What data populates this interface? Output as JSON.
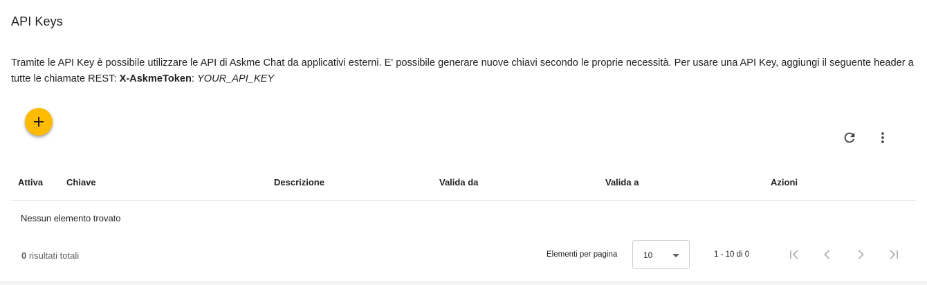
{
  "page": {
    "title": "API Keys",
    "description": {
      "text": "Tramite le API Key è possibile utilizzare le API di Askme Chat da applicativi esterni. E' possibile generare nuove chiavi secondo le proprie necessità. Per usare una API Key, aggiungi il seguente header a tutte le chiamate REST: ",
      "header_name": "X-AskmeToken",
      "separator": ": ",
      "header_value": "YOUR_API_KEY"
    }
  },
  "toolbar": {
    "add_icon": "plus-icon",
    "refresh_icon": "refresh-icon",
    "more_icon": "more-vertical-icon"
  },
  "table": {
    "columns": [
      "Attiva",
      "Chiave",
      "Descrizione",
      "Valida da",
      "Valida a",
      "Azioni"
    ],
    "rows": [],
    "empty_message": "Nessun elemento trovato"
  },
  "footer": {
    "total_count": "0",
    "total_label": " risultati totali",
    "per_page_label": "Elementi per pagina",
    "per_page_value": "10",
    "range_label": "1 - 10 di 0",
    "nav_icons": [
      "first-page-icon",
      "prev-page-icon",
      "next-page-icon",
      "last-page-icon"
    ]
  },
  "colors": {
    "fab": "#ffbb00",
    "divider": "#e0e0e0",
    "disabled_icon": "#b0b0b0"
  }
}
